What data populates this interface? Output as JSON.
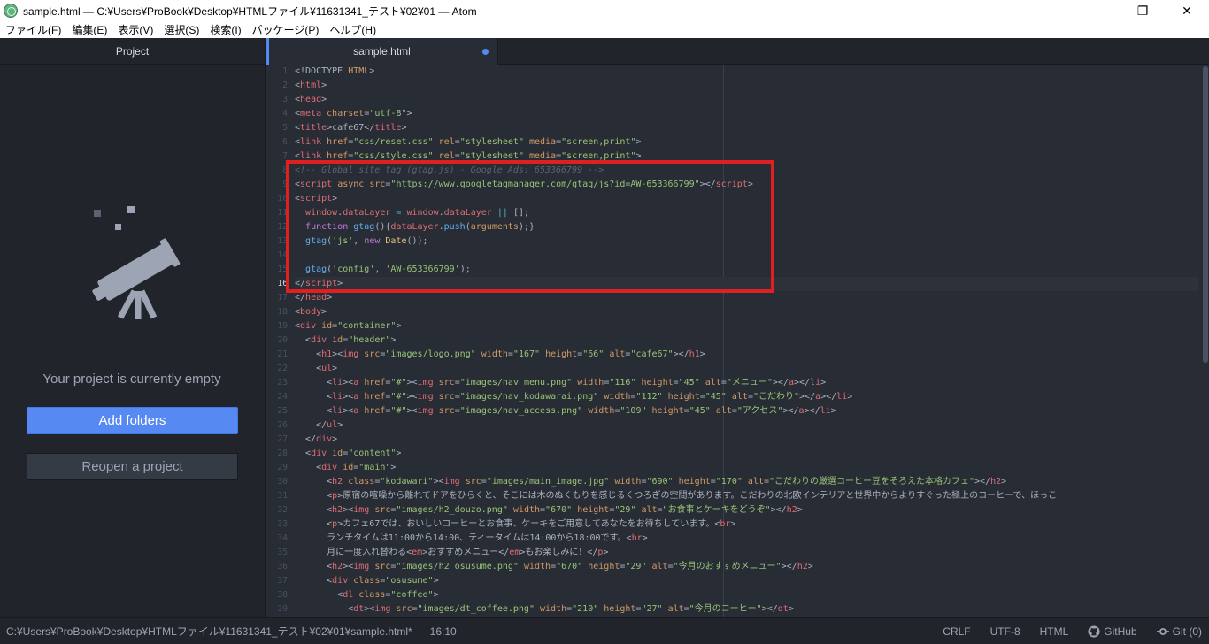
{
  "window": {
    "title": "sample.html — C:¥Users¥ProBook¥Desktop¥HTMLファイル¥11631341_テスト¥02¥01 — Atom",
    "minimize": "—",
    "maximize": "❐",
    "close": "✕"
  },
  "menu": [
    "ファイル(F)",
    "編集(E)",
    "表示(V)",
    "選択(S)",
    "検索(I)",
    "パッケージ(P)",
    "ヘルプ(H)"
  ],
  "sidebar": {
    "title": "Project",
    "empty_message": "Your project is currently empty",
    "add_folders": "Add folders",
    "reopen_project": "Reopen a project"
  },
  "tab": {
    "label": "sample.html"
  },
  "editor": {
    "current_line": 16,
    "start_line": 1
  },
  "status": {
    "path": "C:¥Users¥ProBook¥Desktop¥HTMLファイル¥11631341_テスト¥02¥01¥sample.html*",
    "cursor": "16:10",
    "line_ending": "CRLF",
    "encoding": "UTF-8",
    "grammar": "HTML",
    "github": "GitHub",
    "git": "Git (0)"
  },
  "colors": {
    "accent": "#568af2",
    "highlight_box": "#e02020",
    "tag": "#e06c75",
    "attribute": "#d19a66",
    "string": "#98c379",
    "comment": "#5c6370"
  }
}
